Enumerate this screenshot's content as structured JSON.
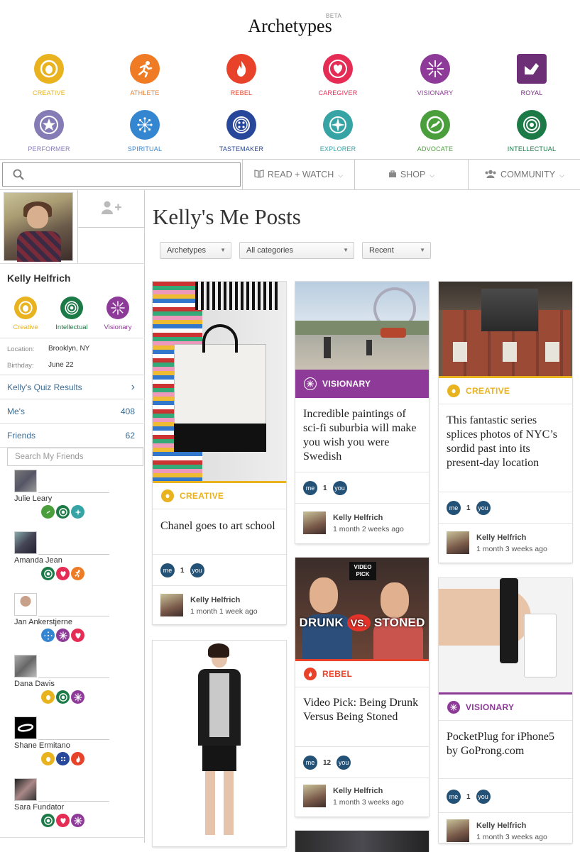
{
  "brand": {
    "logo": "Archetypes",
    "beta": "BETA"
  },
  "archetypes": [
    {
      "label": "CREATIVE",
      "color": "#e9b21f",
      "icon": "creative-icon"
    },
    {
      "label": "ATHLETE",
      "color": "#ef7b24",
      "icon": "athlete-icon"
    },
    {
      "label": "REBEL",
      "color": "#e8432a",
      "icon": "rebel-icon"
    },
    {
      "label": "CAREGIVER",
      "color": "#e52c54",
      "icon": "caregiver-icon"
    },
    {
      "label": "VISIONARY",
      "color": "#8e3a98",
      "icon": "visionary-icon"
    },
    {
      "label": "ROYAL",
      "color": "#6d2f75",
      "icon": "royal-icon"
    },
    {
      "label": "PERFORMER",
      "color": "#857cb6",
      "icon": "performer-icon"
    },
    {
      "label": "SPIRITUAL",
      "color": "#3586d0",
      "icon": "spiritual-icon"
    },
    {
      "label": "TASTEMAKER",
      "color": "#26479a",
      "icon": "tastemaker-icon"
    },
    {
      "label": "EXPLORER",
      "color": "#36a3a4",
      "icon": "explorer-icon"
    },
    {
      "label": "ADVOCATE",
      "color": "#4a9f3c",
      "icon": "advocate-icon"
    },
    {
      "label": "INTELLECTUAL",
      "color": "#1c7a47",
      "icon": "intellectual-icon"
    }
  ],
  "nav": {
    "search_placeholder": "",
    "read_watch": "READ + WATCH",
    "shop": "SHOP",
    "community": "COMMUNITY"
  },
  "profile": {
    "name": "Kelly Helfrich",
    "archetypes": [
      "Creative",
      "Intellectual",
      "Visionary"
    ],
    "location_label": "Location:",
    "location": "Brooklyn, NY",
    "birthday_label": "Birthday:",
    "birthday": "June 22",
    "quiz_link": "Kelly's Quiz Results",
    "mes_label": "Me's",
    "mes_count": "408",
    "friends_label": "Friends",
    "friends_count": "62",
    "friend_search_placeholder": "Search My Friends"
  },
  "friends": [
    {
      "name": "Julie Leary"
    },
    {
      "name": "Amanda Jean"
    },
    {
      "name": "Jan Ankerstjerne"
    },
    {
      "name": "Dana Davis"
    },
    {
      "name": "Shane Ermitano"
    },
    {
      "name": "Sara Fundator"
    }
  ],
  "main": {
    "title": "Kelly's Me Posts",
    "filters": [
      "Archetypes",
      "All categories",
      "Recent"
    ]
  },
  "posts": [
    {
      "category": "CREATIVE",
      "title": "Chanel goes to art school",
      "votes": "1",
      "author": "Kelly Helfrich",
      "time": "1 month 1 week ago"
    },
    {
      "category": "VISIONARY",
      "title": "Incredible paintings of sci-fi suburbia will make you wish you were Swedish",
      "votes": "1",
      "author": "Kelly Helfrich",
      "time": "1 month 2 weeks ago"
    },
    {
      "category": "CREATIVE",
      "title": "This fantastic series splices photos of NYC’s sordid past into its present-day location",
      "votes": "1",
      "author": "Kelly Helfrich",
      "time": "1 month 3 weeks ago"
    },
    {
      "category": "REBEL",
      "title": "Video Pick: Being Drunk Versus Being Stoned",
      "votes": "12",
      "author": "Kelly Helfrich",
      "time": "1 month 3 weeks ago",
      "image_text_top": "VIDEO PICK",
      "image_text_a": "DRUNK",
      "image_text_vs": "VS.",
      "image_text_b": "STONED"
    },
    {
      "category": "VISIONARY",
      "title": "PocketPlug for iPhone5 by GoProng.com",
      "votes": "1",
      "author": "Kelly Helfrich",
      "time": "1 month 3 weeks ago"
    }
  ],
  "badges": {
    "me": "me",
    "you": "you"
  }
}
